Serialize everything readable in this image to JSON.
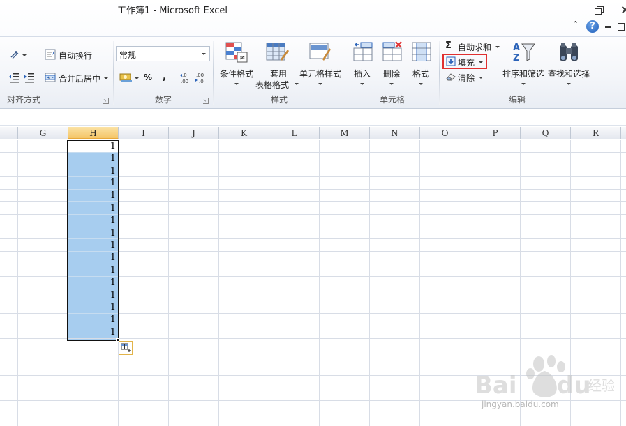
{
  "window": {
    "title": "工作簿1  -  Microsoft Excel"
  },
  "ribbon": {
    "alignment": {
      "label": "对齐方式",
      "wrap_text": "自动换行",
      "merge_center": "合并后居中"
    },
    "number": {
      "label": "数字",
      "format_value": "常规",
      "percent": "%",
      "comma": ",",
      "inc_decimal": "←.0 .00",
      "dec_decimal": ".00 →.0"
    },
    "styles": {
      "label": "样式",
      "conditional_format": "条件格式",
      "format_table_line1": "套用",
      "format_table_line2": "表格格式",
      "cell_styles": "单元格样式"
    },
    "cells": {
      "label": "单元格",
      "insert": "插入",
      "delete": "删除",
      "format": "格式"
    },
    "editing": {
      "label": "编辑",
      "autosum": "自动求和",
      "fill": "填充",
      "clear": "清除",
      "sort_filter": "排序和筛选",
      "find_select": "查找和选择"
    }
  },
  "grid": {
    "columns": [
      "G",
      "H",
      "I",
      "J",
      "K",
      "L",
      "M",
      "N",
      "O",
      "P",
      "Q",
      "R"
    ],
    "selected_column": "H",
    "cell_values": [
      "1",
      "1",
      "1",
      "1",
      "1",
      "1",
      "1",
      "1",
      "1",
      "1",
      "1",
      "1",
      "1",
      "1",
      "1",
      "1"
    ]
  },
  "watermark": {
    "text": "jingyan.baidu.com"
  },
  "colors": {
    "selection": "#a7cdef",
    "highlight_box": "#e03030",
    "selected_header": "#f4c567"
  }
}
